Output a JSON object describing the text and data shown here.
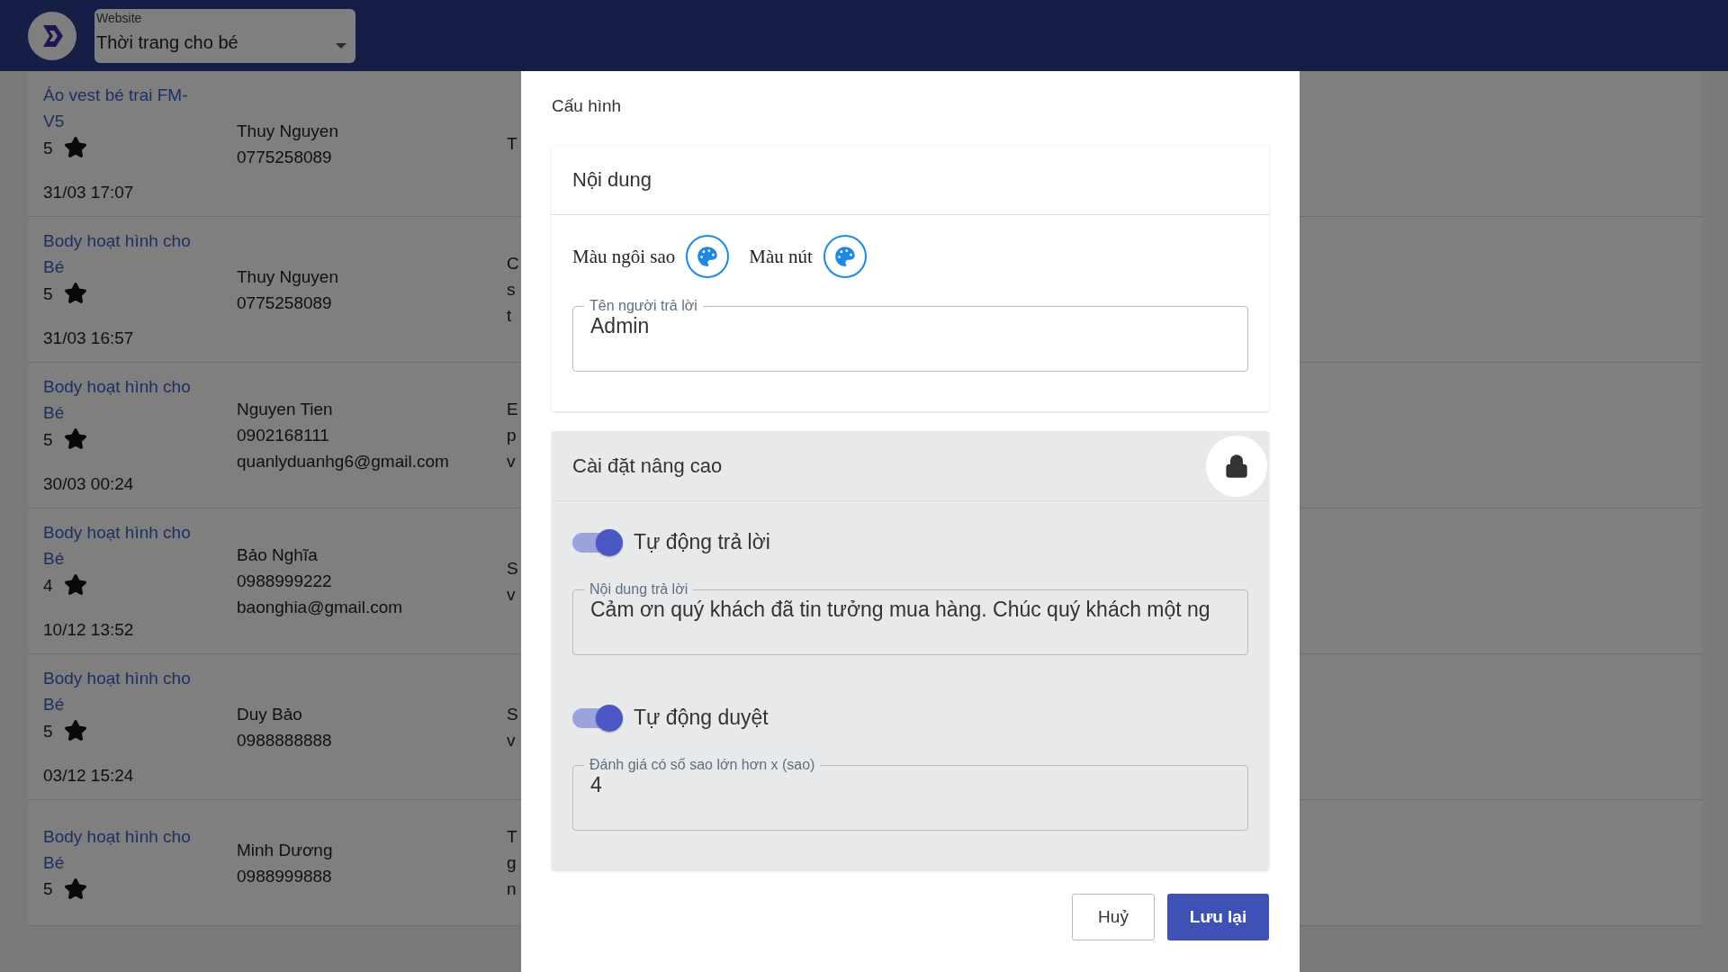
{
  "header": {
    "website_select": {
      "label": "Website",
      "value": "Thời trang cho bé"
    }
  },
  "reviews": [
    {
      "product": "Áo vest bé trai FM-V5",
      "rating": "5",
      "date": "31/03 17:07",
      "customer": [
        "Thuy Nguyen",
        "0775258089"
      ],
      "column_3": [
        "T"
      ]
    },
    {
      "product": "Body hoạt hình cho Bé",
      "rating": "5",
      "date": "31/03 16:57",
      "customer": [
        "Thuy Nguyen",
        "0775258089"
      ],
      "column_3": [
        "C",
        "s",
        "t"
      ]
    },
    {
      "product": "Body hoạt hình cho Bé",
      "rating": "5",
      "date": "30/03 00:24",
      "customer": [
        "Nguyen Tien",
        "0902168111",
        "quanlyduanhg6@gmail.com"
      ],
      "column_3": [
        "E",
        "p",
        "v"
      ]
    },
    {
      "product": "Body hoạt hình cho Bé",
      "rating": "4",
      "date": "10/12 13:52",
      "customer": [
        "Bảo Nghĩa",
        "0988999222",
        "baonghia@gmail.com"
      ],
      "column_3": [
        "S",
        "v"
      ]
    },
    {
      "product": "Body hoạt hình cho Bé",
      "rating": "5",
      "date": "03/12 15:24",
      "customer": [
        "Duy Bảo",
        "0988888888"
      ],
      "column_3": [
        "S",
        "v"
      ]
    },
    {
      "product": "Body hoạt hình cho Bé",
      "rating": "5",
      "customer": [
        "Minh Dương",
        "0988999888"
      ],
      "column_3": [
        "T",
        "g",
        "n"
      ]
    }
  ],
  "dialog": {
    "title": "Cấu hình",
    "content_card": {
      "title": "Nội dung",
      "color_pickers": [
        "Màu ngôi sao",
        "Màu nút"
      ],
      "responder_field": {
        "label": "Tên người trả lời",
        "value": "Admin"
      }
    },
    "advanced_card": {
      "title": "Cài đặt nâng cao",
      "locked": true,
      "auto_reply": {
        "label": "Tự động trả lời",
        "on": true
      },
      "reply_field": {
        "label": "Nội dung trả lời",
        "value": "Cảm ơn quý khách đã tin tưởng mua hàng. Chúc quý khách một ng"
      },
      "auto_approve": {
        "label": "Tự động duyệt",
        "on": true
      },
      "min_stars_field": {
        "label": "Đánh giá có số sao lớn hơn x (sao)",
        "value": "4"
      }
    },
    "buttons": {
      "cancel": "Huỷ",
      "save": "Lưu lại"
    }
  }
}
